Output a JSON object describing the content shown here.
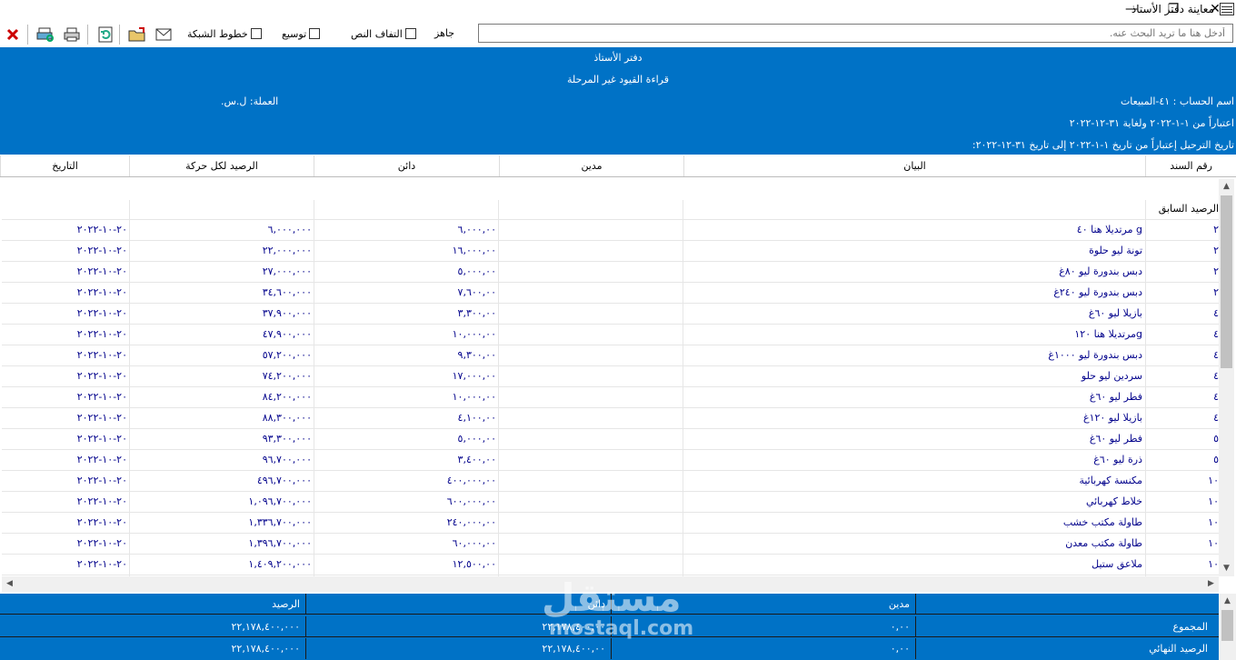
{
  "window": {
    "title": "معاينة دفتر الأستاذ",
    "minimize": "—",
    "maximize": "❐",
    "close": "✕"
  },
  "toolbar": {
    "grid_lines_label": "خطوط الشبكة",
    "expand_label": "توسيع",
    "wrap_text_label": "التفاف النص",
    "status": "جاهز",
    "search_placeholder": "أدخل هنا ما تريد البحث عنه."
  },
  "header": {
    "title": "دفتر الأستاذ",
    "subtitle": "قراءة القيود غير المرحلة",
    "account": "اسم الحساب : ٤١-المبيعات",
    "currency": "العملة: ل.س.",
    "period": "اعتباراً من  ١-١-٢٠٢٢ ولغاية  ٣١-١٢-٢٠٢٢",
    "posting_period": "تاريخ الترحيل إعتباراً من تاريخ  ١-١-٢٠٢٢ إلى تاريخ  ٣١-١٢-٢٠٢٢:"
  },
  "columns": {
    "entry_no": "رقم السند",
    "description": "البيان",
    "debit": "مدين",
    "credit": "دائن",
    "balance": "الرصيد لكل حركة",
    "date": "التاريخ"
  },
  "previous_balance_label": "الرصيد السابق",
  "rows": [
    {
      "no": "٢",
      "desc": "مرتديلا هنا ٤٠ g",
      "debit": "",
      "credit": "٦,٠٠٠,٠٠",
      "balance": "٦,٠٠٠,٠٠٠",
      "date": "٢٠-١٠-٢٠٢٢"
    },
    {
      "no": "٢",
      "desc": "تونة ليو حلوة",
      "debit": "",
      "credit": "١٦,٠٠٠,٠٠",
      "balance": "٢٢,٠٠٠,٠٠٠",
      "date": "٢٠-١٠-٢٠٢٢"
    },
    {
      "no": "٢",
      "desc": "دبس بندورة ليو ٨٠غ",
      "debit": "",
      "credit": "٥,٠٠٠,٠٠",
      "balance": "٢٧,٠٠٠,٠٠٠",
      "date": "٢٠-١٠-٢٠٢٢"
    },
    {
      "no": "٢",
      "desc": "دبس بندورة ليو ٢٤٠غ",
      "debit": "",
      "credit": "٧,٦٠٠,٠٠",
      "balance": "٣٤,٦٠٠,٠٠٠",
      "date": "٢٠-١٠-٢٠٢٢"
    },
    {
      "no": "٤",
      "desc": "بازيلا ليو ٦٠غ",
      "debit": "",
      "credit": "٣,٣٠٠,٠٠",
      "balance": "٣٧,٩٠٠,٠٠٠",
      "date": "٢٠-١٠-٢٠٢٢"
    },
    {
      "no": "٤",
      "desc": "مرتديلا هنا ١٢٠g",
      "debit": "",
      "credit": "١٠,٠٠٠,٠٠",
      "balance": "٤٧,٩٠٠,٠٠٠",
      "date": "٢٠-١٠-٢٠٢٢"
    },
    {
      "no": "٤",
      "desc": "دبس بندورة ليو ١٠٠٠غ",
      "debit": "",
      "credit": "٩,٣٠٠,٠٠",
      "balance": "٥٧,٢٠٠,٠٠٠",
      "date": "٢٠-١٠-٢٠٢٢"
    },
    {
      "no": "٤",
      "desc": "سردين ليو حلو",
      "debit": "",
      "credit": "١٧,٠٠٠,٠٠",
      "balance": "٧٤,٢٠٠,٠٠٠",
      "date": "٢٠-١٠-٢٠٢٢"
    },
    {
      "no": "٤",
      "desc": "فطر ليو ٦٠غ",
      "debit": "",
      "credit": "١٠,٠٠٠,٠٠",
      "balance": "٨٤,٢٠٠,٠٠٠",
      "date": "٢٠-١٠-٢٠٢٢"
    },
    {
      "no": "٤",
      "desc": "بازيلا ليو ١٢٠غ",
      "debit": "",
      "credit": "٤,١٠٠,٠٠",
      "balance": "٨٨,٣٠٠,٠٠٠",
      "date": "٢٠-١٠-٢٠٢٢"
    },
    {
      "no": "٥",
      "desc": "فطر ليو ٦٠غ",
      "debit": "",
      "credit": "٥,٠٠٠,٠٠",
      "balance": "٩٣,٣٠٠,٠٠٠",
      "date": "٢٠-١٠-٢٠٢٢"
    },
    {
      "no": "٥",
      "desc": "ذرة ليو ٦٠غ",
      "debit": "",
      "credit": "٣,٤٠٠,٠٠",
      "balance": "٩٦,٧٠٠,٠٠٠",
      "date": "٢٠-١٠-٢٠٢٢"
    },
    {
      "no": "١٠",
      "desc": "مكنسة كهربائية",
      "debit": "",
      "credit": "٤٠٠,٠٠٠,٠٠",
      "balance": "٤٩٦,٧٠٠,٠٠٠",
      "date": "٢٠-١٠-٢٠٢٢"
    },
    {
      "no": "١٠",
      "desc": "خلاط كهربائي",
      "debit": "",
      "credit": "٦٠٠,٠٠٠,٠٠",
      "balance": "١,٠٩٦,٧٠٠,٠٠٠",
      "date": "٢٠-١٠-٢٠٢٢"
    },
    {
      "no": "١٠",
      "desc": "طاولة مكتب خشب",
      "debit": "",
      "credit": "٢٤٠,٠٠٠,٠٠",
      "balance": "١,٣٣٦,٧٠٠,٠٠٠",
      "date": "٢٠-١٠-٢٠٢٢"
    },
    {
      "no": "١٠",
      "desc": "طاولة مكتب معدن",
      "debit": "",
      "credit": "٦٠,٠٠٠,٠٠",
      "balance": "١,٣٩٦,٧٠٠,٠٠٠",
      "date": "٢٠-١٠-٢٠٢٢"
    },
    {
      "no": "١٠",
      "desc": "ملاعق ستيل",
      "debit": "",
      "credit": "١٢,٥٠٠,٠٠",
      "balance": "١,٤٠٩,٢٠٠,٠٠٠",
      "date": "٢٠-١٠-٢٠٢٢"
    }
  ],
  "footer": {
    "header": {
      "debit": "مدين",
      "credit": "دائن",
      "balance": "الرصيد"
    },
    "total": {
      "label": "المجموع",
      "debit": "٠,٠٠",
      "credit": "٢٢,١٧٨,٤٠٠,٠٠",
      "balance": "٢٢,١٧٨,٤٠٠,٠٠٠"
    },
    "final": {
      "label": "الرصيد النهائي",
      "debit": "٠,٠٠",
      "credit": "٢٢,١٧٨,٤٠٠,٠٠",
      "balance": "٢٢,١٧٨,٤٠٠,٠٠٠"
    }
  },
  "watermark": {
    "arabic": "مستقل",
    "latin": "mostaql.com"
  },
  "colors": {
    "header_blue": "#0072c6",
    "row_text": "#00008b"
  }
}
